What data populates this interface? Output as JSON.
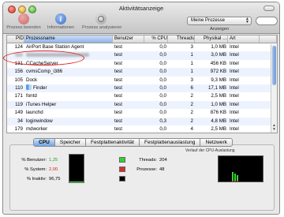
{
  "window": {
    "title": "Aktivitätsanzeige"
  },
  "toolbar": {
    "quit_label": "Prozess beenden",
    "info_label": "Informationen",
    "sample_label": "Prozess analysieren",
    "filter_value": "Meine Prozesse",
    "filter_caption": "Anzeigen"
  },
  "table": {
    "columns": [
      "PID",
      "Prozessname",
      "Benutzer",
      "% CPU",
      "Threads",
      "Physikal …",
      "Art"
    ],
    "rows": [
      {
        "pid": "124",
        "name": "AirPort Base Station Agent",
        "user": "test",
        "cpu": "0,0",
        "threads": "3",
        "mem": "1,0 MB",
        "art": "Intel"
      },
      {
        "pid": "",
        "name": "",
        "user": "test",
        "cpu": "0,0",
        "threads": "1",
        "mem": "3,0 MB",
        "art": "Intel"
      },
      {
        "pid": "131",
        "name": "CCacheServer",
        "user": "test",
        "cpu": "0,0",
        "threads": "1",
        "mem": "456 KB",
        "art": "Intel"
      },
      {
        "pid": "156",
        "name": "cvmsComp_i386",
        "user": "test",
        "cpu": "0,0",
        "threads": "1",
        "mem": "972 KB",
        "art": "Intel"
      },
      {
        "pid": "105",
        "name": "Dock",
        "user": "test",
        "cpu": "0,0",
        "threads": "3",
        "mem": "9,3 MB",
        "art": "Intel"
      },
      {
        "pid": "110",
        "name": "Finder",
        "user": "test",
        "cpu": "0,0",
        "threads": "6",
        "mem": "17,1 MB",
        "art": "Intel"
      },
      {
        "pid": "171",
        "name": "fontd",
        "user": "test",
        "cpu": "0,0",
        "threads": "2",
        "mem": "2,5 MB",
        "art": "Intel"
      },
      {
        "pid": "119",
        "name": "iTunes Helper",
        "user": "test",
        "cpu": "0,0",
        "threads": "2",
        "mem": "1,0 MB",
        "art": "Intel"
      },
      {
        "pid": "149",
        "name": "launchd",
        "user": "test",
        "cpu": "0,0",
        "threads": "2",
        "mem": "876 KB",
        "art": "Intel"
      },
      {
        "pid": "34",
        "name": "loginwindow",
        "user": "test",
        "cpu": "0,3",
        "threads": "2",
        "mem": "4,8 MB",
        "art": "Intel"
      },
      {
        "pid": "179",
        "name": "mdworker",
        "user": "test",
        "cpu": "0,0",
        "threads": "4",
        "mem": "2,5 MB",
        "art": "Intel"
      }
    ]
  },
  "tabs": [
    "CPU",
    "Speicher",
    "Festplattenaktivität",
    "Festplattenauslastung",
    "Netzwerk"
  ],
  "cpu_panel": {
    "user_label": "% Benutzer:",
    "user_value": "1,25",
    "system_label": "% System:",
    "system_value": "2,00",
    "idle_label": "% Inaktiv:",
    "idle_value": "96,75",
    "threads_label": "Threads:",
    "threads_value": "204",
    "processes_label": "Prozesse:",
    "processes_value": "48",
    "history_title": "Verlauf der CPU-Auslastung",
    "usage_fraction": 0.0325
  },
  "colors": {
    "user": "#2fd42f",
    "system": "#e02a2a",
    "idle": "#000000",
    "annotation": "#e02020",
    "accent": "#6ea2e4"
  },
  "icons": {
    "quit": "stop-icon",
    "info": "info-icon",
    "sample": "sample-icon",
    "finder": "finder-app-icon"
  }
}
